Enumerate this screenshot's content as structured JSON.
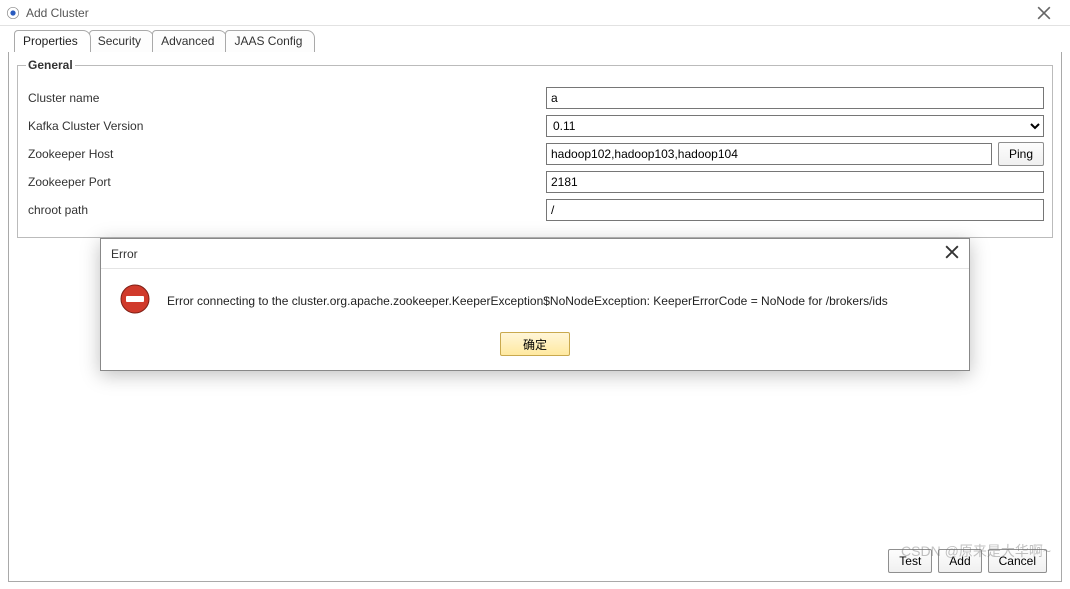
{
  "window": {
    "title": "Add Cluster"
  },
  "tabs": {
    "items": [
      {
        "label": "Properties"
      },
      {
        "label": "Security"
      },
      {
        "label": "Advanced"
      },
      {
        "label": "JAAS Config"
      }
    ],
    "active_index": 0
  },
  "general": {
    "legend": "General",
    "cluster_name": {
      "label": "Cluster name",
      "value": "a"
    },
    "kafka_version": {
      "label": "Kafka Cluster Version",
      "value": "0.11"
    },
    "zk_host": {
      "label": "Zookeeper Host",
      "value": "hadoop102,hadoop103,hadoop104",
      "ping_label": "Ping"
    },
    "zk_port": {
      "label": "Zookeeper Port",
      "value": "2181"
    },
    "chroot": {
      "label": "chroot path",
      "value": "/"
    }
  },
  "error_dialog": {
    "title": "Error",
    "message": "Error connecting to the cluster.org.apache.zookeeper.KeeperException$NoNodeException: KeeperErrorCode = NoNode for /brokers/ids",
    "ok_label": "确定"
  },
  "footer": {
    "test_label": "Test",
    "add_label": "Add",
    "cancel_label": "Cancel"
  },
  "watermark": "CSDN @原来是大华啊~"
}
